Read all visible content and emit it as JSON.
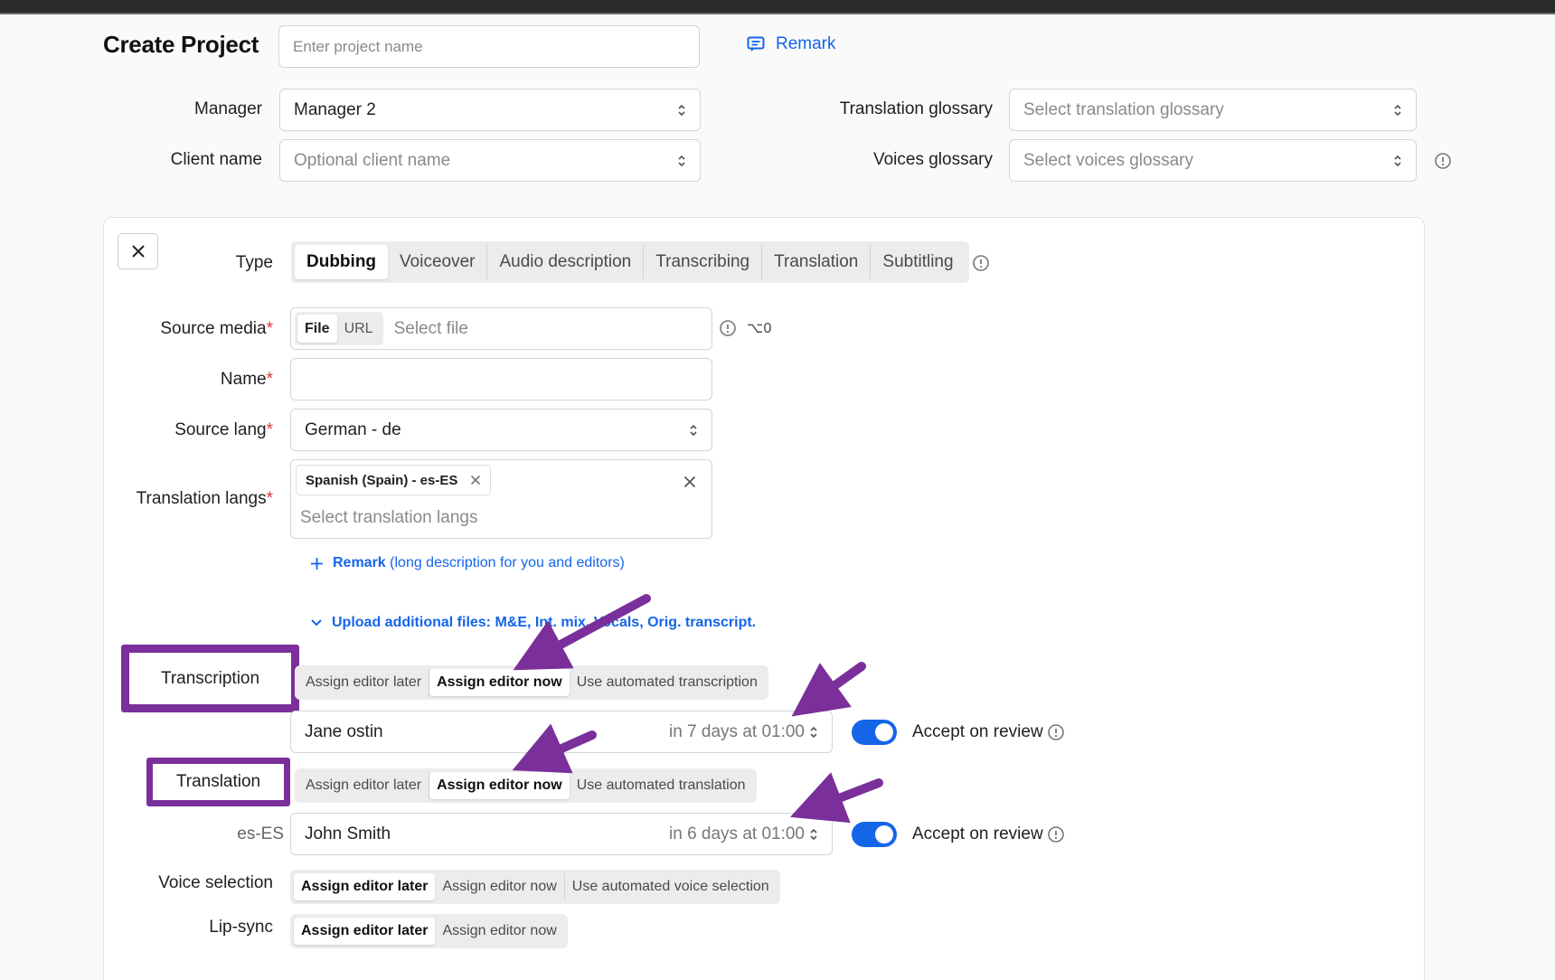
{
  "header": {
    "title": "Create Project",
    "project_name_placeholder": "Enter project name",
    "remark_label": "Remark"
  },
  "project_fields": {
    "manager_label": "Manager",
    "manager_value": "Manager 2",
    "client_label": "Client name",
    "client_placeholder": "Optional client name",
    "translation_glossary_label": "Translation glossary",
    "translation_glossary_placeholder": "Select translation glossary",
    "voices_glossary_label": "Voices glossary",
    "voices_glossary_placeholder": "Select voices glossary"
  },
  "task": {
    "type_label": "Type",
    "type_tabs": [
      "Dubbing",
      "Voiceover",
      "Audio description",
      "Transcribing",
      "Translation",
      "Subtitling"
    ],
    "type_active": "Dubbing",
    "source_media_label": "Source media",
    "source_media_tabs": [
      "File",
      "URL"
    ],
    "source_media_placeholder": "Select file",
    "source_media_shortcut": "⌥0",
    "name_label": "Name",
    "name_value": "",
    "source_lang_label": "Source lang",
    "source_lang_value": "German - de",
    "translation_langs_label": "Translation langs",
    "translation_langs_selected": [
      "Spanish (Spain) - es-ES"
    ],
    "translation_langs_placeholder": "Select translation langs",
    "required_mark": "*",
    "remark_link_bold": "Remark",
    "remark_link_rest": "(long description for you and editors)",
    "upload_link": "Upload additional files: M&E, Int. mix, Vocals, Orig. transcript."
  },
  "stages": {
    "transcription": {
      "label": "Transcription",
      "options": [
        "Assign editor later",
        "Assign editor now",
        "Use automated transcription"
      ],
      "active": "Assign editor now",
      "editor": "Jane ostin",
      "due": "in 7 days at 01:00",
      "accept_label": "Accept on review",
      "accept_on": true
    },
    "translation": {
      "label": "Translation",
      "options": [
        "Assign editor later",
        "Assign editor now",
        "Use automated translation"
      ],
      "active": "Assign editor now",
      "lang_label": "es-ES",
      "editor": "John Smith",
      "due": "in 6 days at 01:00",
      "accept_label": "Accept on review",
      "accept_on": true
    },
    "voice_selection": {
      "label": "Voice selection",
      "options": [
        "Assign editor later",
        "Assign editor now",
        "Use automated voice selection"
      ],
      "active": "Assign editor later"
    },
    "lip_sync": {
      "label": "Lip-sync",
      "options": [
        "Assign editor later",
        "Assign editor now"
      ],
      "active": "Assign editor later"
    }
  },
  "colors": {
    "accent": "#1565e8",
    "annotation": "#7a2f9a",
    "required": "#e5333b"
  }
}
